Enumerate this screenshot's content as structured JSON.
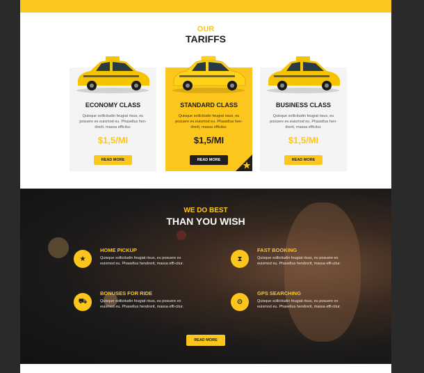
{
  "tariffs": {
    "our": "OUR",
    "title": "TARIFFS",
    "cards": [
      {
        "name": "ECONOMY CLASS",
        "desc": "Quisque sollicitudin feugiat risus, eu posuere ex euismod eu. Phasellus hen-drerit, massa efficitur.",
        "price": "$1,5/MI",
        "button": "READ MORE"
      },
      {
        "name": "STANDARD CLASS",
        "desc": "Quisque sollicitudin feugiat risus, eu posuere ex euismod eu. Phasellus hen-drerit, massa efficitur.",
        "price": "$1,5/MI",
        "button": "READ MORE"
      },
      {
        "name": "BUSINESS CLASS",
        "desc": "Quisque sollicitudin feugiat risus, eu posuere ex euismod eu. Phasellus hen-drerit, massa efficitur.",
        "price": "$1,5/MI",
        "button": "READ MORE"
      }
    ]
  },
  "features": {
    "kicker": "WE DO BEST",
    "title": "THAN YOU WISH",
    "items": [
      {
        "title": "HOME PICKUP",
        "desc": "Quisque sollicitudin feugiat risus, eu posuere ex euismod eu. Phasellus hendrerit, massa effi-citur.",
        "icon": "star-icon"
      },
      {
        "title": "FAST BOOKING",
        "desc": "Quisque sollicitudin feugiat risus, eu posuere ex euismod eu. Phasellus hendrerit, massa effi-citur.",
        "icon": "hourglass-icon"
      },
      {
        "title": "BONUSES FOR RIDE",
        "desc": "Quisque sollicitudin feugiat risus, eu posuere ex euismod eu. Phasellus hendrerit, massa effi-citur.",
        "icon": "car-icon"
      },
      {
        "title": "GPS SEARCHING",
        "desc": "Quisque sollicitudin feugiat risus, eu posuere ex euismod eu. Phasellus hendrerit, massa effi-citur.",
        "icon": "gear-icon"
      }
    ],
    "button": "READ MORE"
  },
  "colors": {
    "accent": "#fdc61d",
    "dark": "#1a1a1a",
    "card_bg": "#f4f4f4"
  }
}
